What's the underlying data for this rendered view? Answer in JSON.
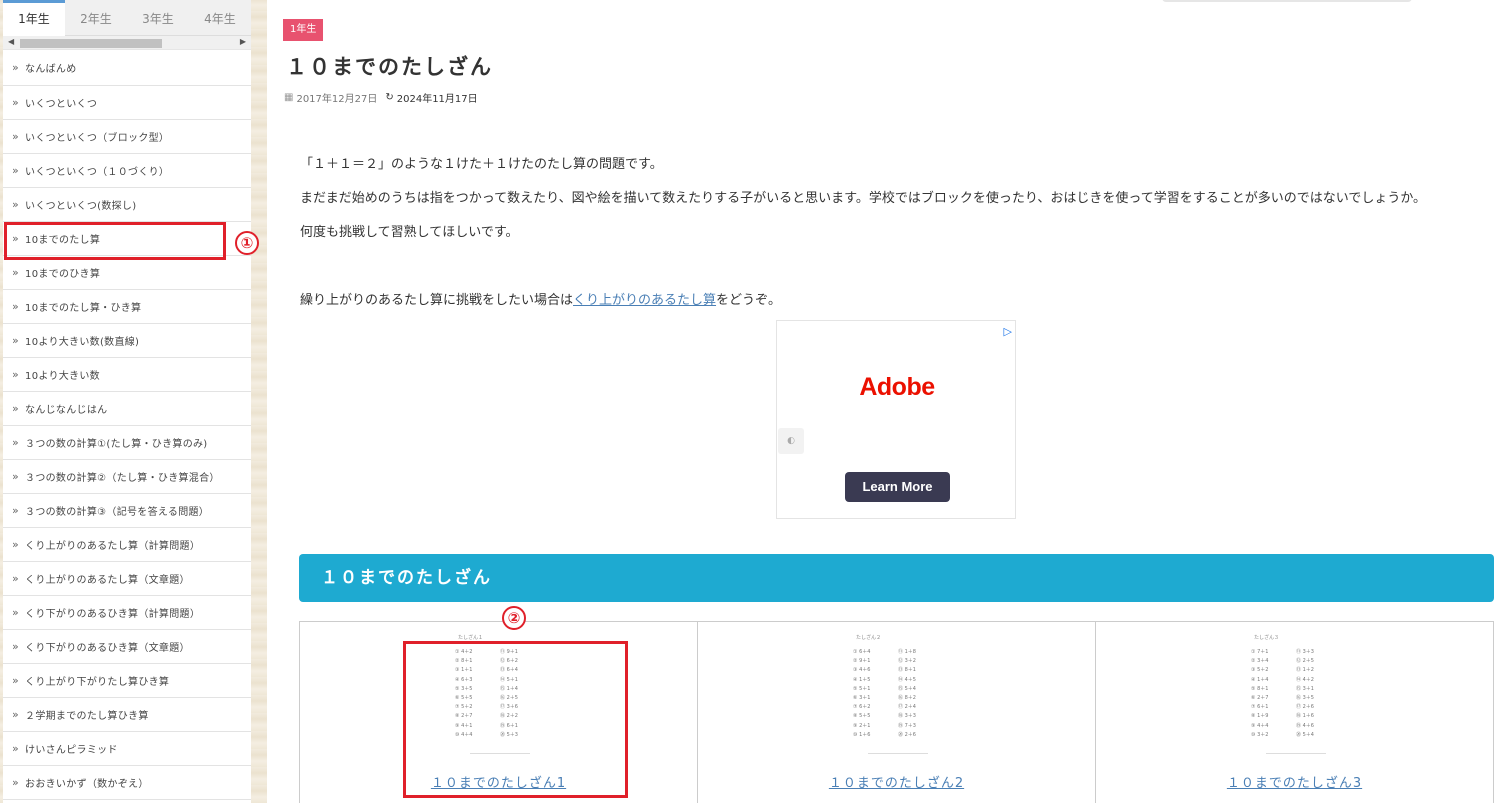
{
  "sidebar": {
    "tabs": [
      "1年生",
      "2年生",
      "3年生",
      "4年生"
    ],
    "active_tab": 0,
    "items": [
      "なんばんめ",
      "いくつといくつ",
      "いくつといくつ（ブロック型）",
      "いくつといくつ（１０づくり）",
      "いくつといくつ(数探し)",
      "10までのたし算",
      "10までのひき算",
      "10までのたし算・ひき算",
      "10より大きい数(数直線)",
      "10より大きい数",
      "なんじなんじはん",
      "３つの数の計算①(たし算・ひき算のみ)",
      "３つの数の計算②（たし算・ひき算混合）",
      "３つの数の計算③（記号を答える問題）",
      "くり上がりのあるたし算（計算問題）",
      "くり上がりのあるたし算（文章題）",
      "くり下がりのあるひき算（計算問題）",
      "くり下がりのあるひき算（文章題）",
      "くり上がり下がりたし算ひき算",
      "２学期までのたし算ひき算",
      "けいさんピラミッド",
      "おおきいかず（数かぞえ）"
    ]
  },
  "annotations": [
    "①",
    "②"
  ],
  "main": {
    "category": "1年生",
    "title": "１０までのたしざん",
    "published": "2017年12月27日",
    "updated": "2024年11月17日",
    "paragraphs": [
      "「１＋１＝２」のような１けた＋１けたのたし算の問題です。",
      "まだまだ始めのうちは指をつかって数えたり、図や絵を描いて数えたりする子がいると思います。学校ではブロックを使ったり、おはじきを使って学習をすることが多いのではないでしょうか。",
      "何度も挑戦して習熟してほしいです。"
    ],
    "link_para": {
      "before": "繰り上がりのあるたし算に挑戦をしたい場合は",
      "link": "くり上がりのあるたし算",
      "after": "をどうぞ。"
    },
    "ad": {
      "logo": "Adobe",
      "cta": "Learn More"
    },
    "section_title": "１０までのたしざん",
    "worksheets": [
      {
        "title": "たしざん１",
        "link": "１０までのたしざん1",
        "left": [
          "① 4＋2",
          "② 8＋1",
          "③ 1＋1",
          "④ 6＋3",
          "⑤ 3＋5",
          "⑥ 5＋5",
          "⑦ 5＋2",
          "⑧ 2＋7",
          "⑨ 4＋1",
          "⑩ 4＋4"
        ],
        "right": [
          "⑪ 9＋1",
          "⑫ 6＋2",
          "⑬ 6＋4",
          "⑭ 5＋1",
          "⑮ 1＋4",
          "⑯ 2＋5",
          "⑰ 3＋6",
          "⑱ 2＋2",
          "⑲ 6＋1",
          "⑳ 5＋3"
        ]
      },
      {
        "title": "たしざん２",
        "link": "１０までのたしざん2",
        "left": [
          "① 6＋4",
          "② 9＋1",
          "③ 4＋6",
          "④ 1＋5",
          "⑤ 5＋1",
          "⑥ 3＋1",
          "⑦ 6＋2",
          "⑧ 5＋5",
          "⑨ 2＋1",
          "⑩ 1＋6"
        ],
        "right": [
          "⑪ 1＋8",
          "⑫ 3＋2",
          "⑬ 8＋1",
          "⑭ 4＋5",
          "⑮ 5＋4",
          "⑯ 8＋2",
          "⑰ 2＋4",
          "⑱ 3＋3",
          "⑲ 7＋3",
          "⑳ 2＋6"
        ]
      },
      {
        "title": "たしざん３",
        "link": "１０までのたしざん3",
        "left": [
          "① 7＋1",
          "② 3＋4",
          "③ 5＋2",
          "④ 1＋4",
          "⑤ 8＋1",
          "⑥ 2＋7",
          "⑦ 6＋1",
          "⑧ 1＋9",
          "⑨ 4＋4",
          "⑩ 3＋2"
        ],
        "right": [
          "⑪ 3＋3",
          "⑫ 2＋5",
          "⑬ 1＋2",
          "⑭ 4＋2",
          "⑮ 3＋1",
          "⑯ 3＋5",
          "⑰ 2＋6",
          "⑱ 1＋6",
          "⑲ 4＋6",
          "⑳ 5＋4"
        ]
      }
    ]
  }
}
